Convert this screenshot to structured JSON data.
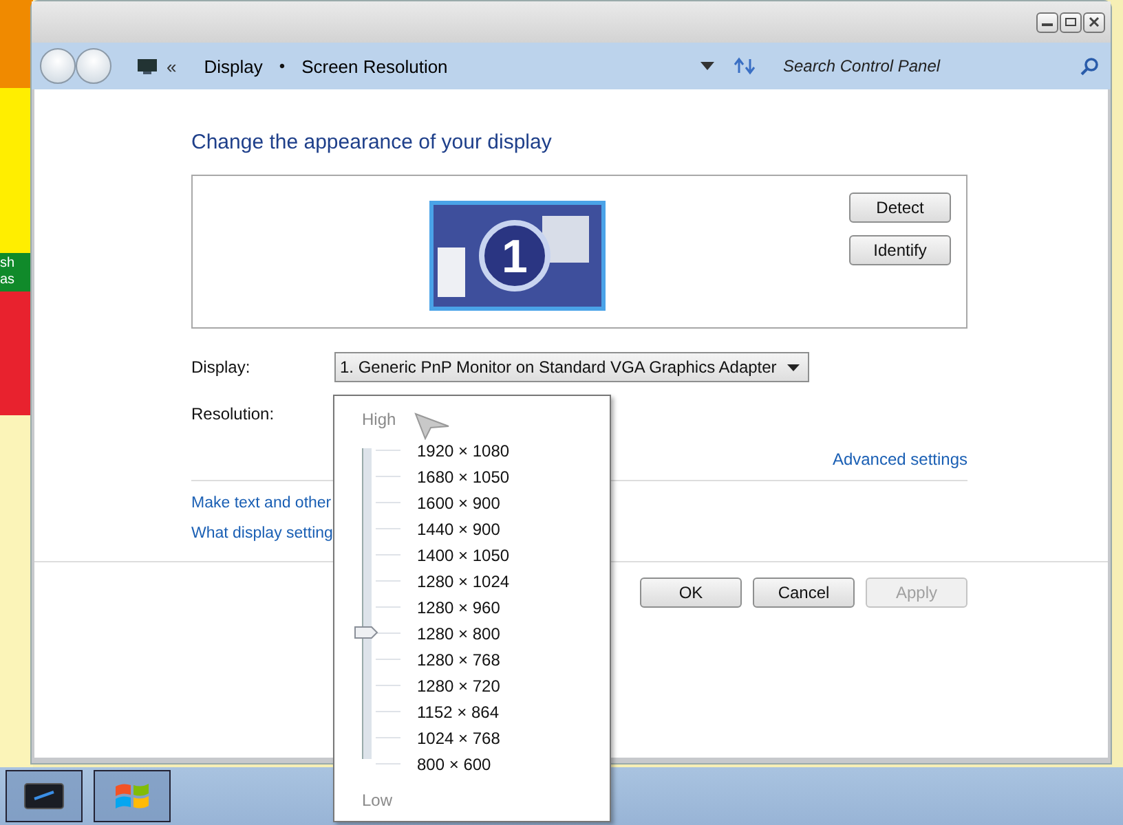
{
  "desktop": {
    "texts": [
      "sh",
      "as"
    ]
  },
  "address_bar": {
    "overflow": "«",
    "breadcrumbs": [
      {
        "label": "Display"
      },
      {
        "label": "Screen Resolution"
      }
    ],
    "separator": "•",
    "search": {
      "placeholder": "Search Control Panel"
    }
  },
  "heading": "Change the appearance of your display",
  "monitor_preview": {
    "number": "1",
    "buttons": [
      "Detect",
      "Identify"
    ]
  },
  "display_field": {
    "label": "Display:",
    "value": "1. Generic PnP Monitor on Standard VGA Graphics Adapter"
  },
  "resolution_field": {
    "label": "Resolution:"
  },
  "advanced_link": "Advanced settings",
  "links": [
    "Make text and other",
    "What display setting"
  ],
  "buttons": [
    {
      "label": "OK",
      "disabled": false
    },
    {
      "label": "Cancel",
      "disabled": false
    },
    {
      "label": "Apply",
      "disabled": true
    }
  ],
  "resolution_popup": {
    "high_label": "High",
    "low_label": "Low",
    "options": [
      {
        "label": "1920 × 1080",
        "selected": false
      },
      {
        "label": "1680 × 1050",
        "selected": false
      },
      {
        "label": "1600 × 900",
        "selected": false
      },
      {
        "label": "1440 × 900",
        "selected": false
      },
      {
        "label": "1400 × 1050",
        "selected": false
      },
      {
        "label": "1280 × 1024",
        "selected": false
      },
      {
        "label": "1280 × 960",
        "selected": false
      },
      {
        "label": "1280 × 800",
        "selected": true
      },
      {
        "label": "1280 × 768",
        "selected": false
      },
      {
        "label": "1280 × 720",
        "selected": false
      },
      {
        "label": "1152 × 864",
        "selected": false
      },
      {
        "label": "1024 × 768",
        "selected": false
      },
      {
        "label": "800 × 600",
        "selected": false
      }
    ]
  }
}
